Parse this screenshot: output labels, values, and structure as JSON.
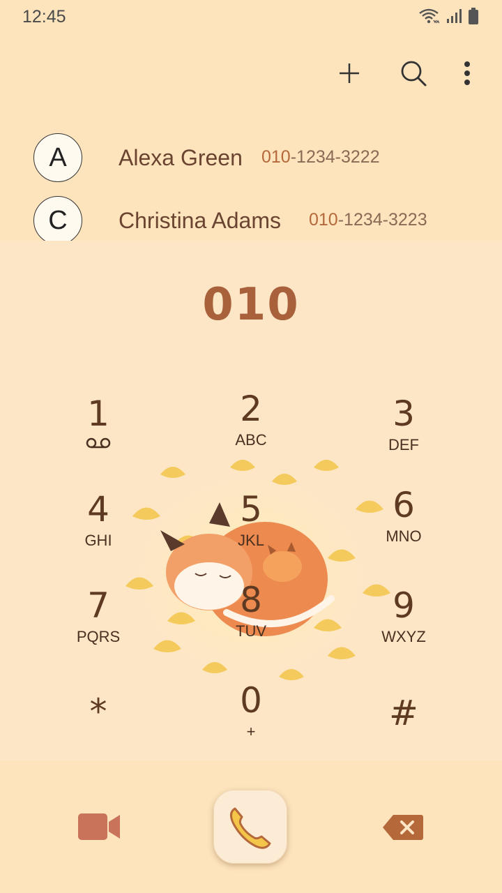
{
  "status": {
    "time": "12:45"
  },
  "toolbar": {
    "icons": [
      "add-icon",
      "search-icon",
      "more-vert-icon"
    ]
  },
  "contacts": [
    {
      "initial": "A",
      "name": "Alexa Green",
      "number_match": "010",
      "number_rest": "-1234-3222"
    },
    {
      "initial": "C",
      "name": "Christina Adams",
      "number_match": "010",
      "number_rest": "-1234-3223"
    }
  ],
  "dial": {
    "value": "010"
  },
  "keypad": [
    {
      "digit": "1",
      "letters": "",
      "icon": "voicemail-icon"
    },
    {
      "digit": "2",
      "letters": "ABC"
    },
    {
      "digit": "3",
      "letters": "DEF"
    },
    {
      "digit": "4",
      "letters": "GHI"
    },
    {
      "digit": "5",
      "letters": "JKL"
    },
    {
      "digit": "6",
      "letters": "MNO"
    },
    {
      "digit": "7",
      "letters": "PQRS"
    },
    {
      "digit": "8",
      "letters": "TUV"
    },
    {
      "digit": "9",
      "letters": "WXYZ"
    },
    {
      "digit": "*",
      "letters": ""
    },
    {
      "digit": "0",
      "letters": "+"
    },
    {
      "digit": "#",
      "letters": ""
    }
  ],
  "actions": {
    "icons": [
      "video-call-icon",
      "phone-icon",
      "backspace-icon"
    ]
  },
  "colors": {
    "accent": "#a8613a",
    "background": "#fde6c6",
    "video": "#c8735a"
  }
}
